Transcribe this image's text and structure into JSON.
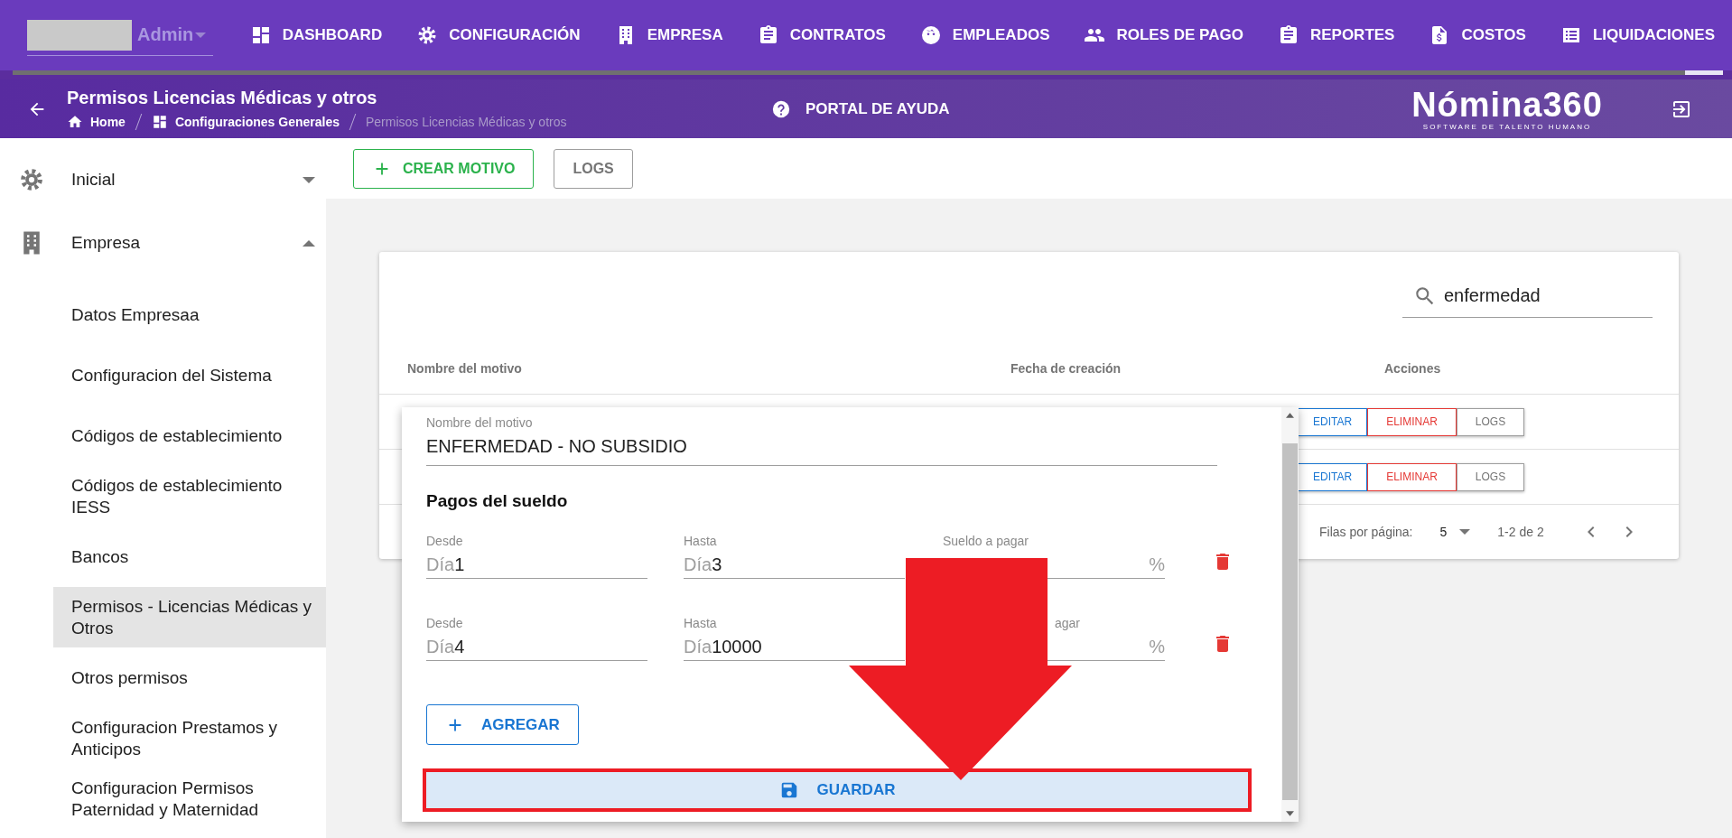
{
  "header": {
    "user": {
      "name": "Admin"
    },
    "nav": [
      {
        "label": "DASHBOARD"
      },
      {
        "label": "CONFIGURACIÓN"
      },
      {
        "label": "EMPRESA"
      },
      {
        "label": "CONTRATOS"
      },
      {
        "label": "EMPLEADOS"
      },
      {
        "label": "ROLES DE PAGO"
      },
      {
        "label": "REPORTES"
      },
      {
        "label": "COSTOS"
      },
      {
        "label": "LIQUIDACIONES"
      }
    ]
  },
  "subheader": {
    "title": "Permisos Licencias Médicas y otros",
    "breadcrumb": [
      {
        "label": "Home"
      },
      {
        "label": "Configuraciones Generales"
      },
      {
        "label": "Permisos Licencias Médicas y otros"
      }
    ],
    "help": "PORTAL DE AYUDA",
    "logo": {
      "name": "Nómina360",
      "tagline": "SOFTWARE DE TALENTO HUMANO"
    }
  },
  "sidebar": {
    "items": [
      {
        "label": "Inicial",
        "expanded": false
      },
      {
        "label": "Empresa",
        "expanded": true,
        "children": [
          {
            "label": "Datos Empresaa",
            "selected": false
          },
          {
            "label": "Configuracion del Sistema",
            "selected": false
          },
          {
            "label": "Códigos de establecimiento",
            "selected": false
          },
          {
            "label": "Códigos de establecimiento IESS",
            "selected": false
          },
          {
            "label": "Bancos",
            "selected": false
          },
          {
            "label": "Permisos - Licencias Médicas y Otros",
            "selected": true
          },
          {
            "label": "Otros permisos",
            "selected": false
          },
          {
            "label": "Configuracion Prestamos y Anticipos",
            "selected": false
          },
          {
            "label": "Configuracion Permisos Paternidad y Maternidad",
            "selected": false
          }
        ]
      }
    ]
  },
  "toolbar": {
    "buttons": [
      {
        "label": "CREAR MOTIVO",
        "kind": "create"
      },
      {
        "label": "LOGS",
        "kind": "plain"
      }
    ]
  },
  "table": {
    "search": {
      "value": "enfermedad"
    },
    "columns": [
      "Nombre del motivo",
      "Fecha de creación",
      "Acciones"
    ],
    "rows": [
      {
        "actions": [
          {
            "label": "EDITAR",
            "kind": "edit"
          },
          {
            "label": "ELIMINAR",
            "kind": "delete"
          },
          {
            "label": "LOGS",
            "kind": "plain"
          }
        ]
      },
      {
        "actions": [
          {
            "label": "EDITAR",
            "kind": "edit"
          },
          {
            "label": "ELIMINAR",
            "kind": "delete"
          },
          {
            "label": "LOGS",
            "kind": "plain"
          }
        ]
      }
    ],
    "footer": {
      "rows_label": "Filas por página:",
      "rows_per_page": "5",
      "range": "1-2 de 2"
    }
  },
  "dialog": {
    "name_field": {
      "label": "Nombre del motivo",
      "value": "ENFERMEDAD - NO SUBSIDIO"
    },
    "section": "Pagos del sueldo",
    "payments": [
      {
        "from": {
          "label": "Desde",
          "prefix": "Día",
          "value": "1"
        },
        "to": {
          "label": "Hasta",
          "prefix": "Día",
          "value": "3"
        },
        "salary": {
          "label": "Sueldo a pagar",
          "suffix": "%",
          "covered": false
        }
      },
      {
        "from": {
          "label": "Desde",
          "prefix": "Día",
          "value": "4"
        },
        "to": {
          "label": "Hasta",
          "prefix": "Día",
          "value": "10000"
        },
        "salary": {
          "label": "agar",
          "suffix": "%",
          "covered": true
        }
      }
    ],
    "add_button": "AGREGAR",
    "save_button": "GUARDAR"
  }
}
